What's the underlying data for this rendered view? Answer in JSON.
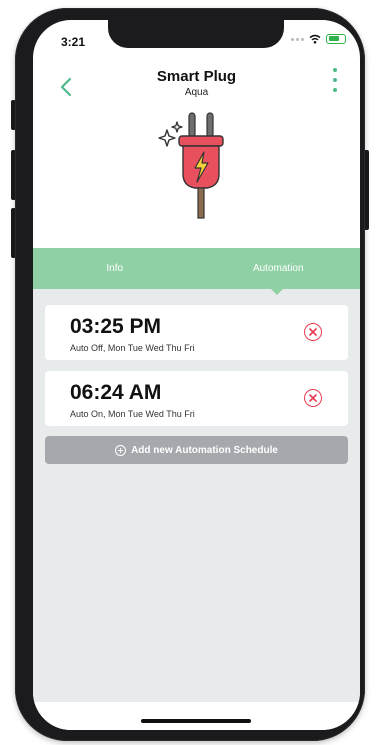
{
  "status": {
    "time": "3:21",
    "battery_color": "#2fb24a"
  },
  "header": {
    "title": "Smart Plug",
    "subtitle": "Aqua",
    "back_icon": "chevron-left-icon",
    "menu_icon": "more-vertical-icon",
    "accent": "#4fb88a"
  },
  "device": {
    "icon": "plug-icon",
    "color": "#e8505e"
  },
  "tabs": [
    {
      "label": "Info",
      "selected": false
    },
    {
      "label": "Automation",
      "selected": true
    }
  ],
  "tab_bar_color": "#8fd0a5",
  "schedules": [
    {
      "time": "03:25 PM",
      "detail": "Auto Off, Mon Tue Wed Thu Fri"
    },
    {
      "time": "06:24 AM",
      "detail": "Auto On, Mon Tue Wed Thu Fri"
    }
  ],
  "remove_icon_color": "#e83b52",
  "add_button": {
    "label": "Add new Automation Schedule",
    "icon": "plus-circle-icon"
  }
}
